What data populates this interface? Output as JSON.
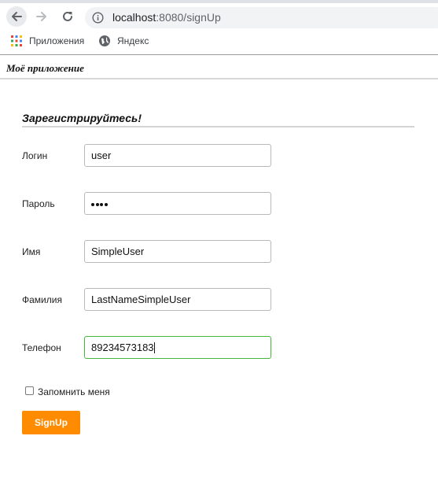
{
  "browser": {
    "url_host": "localhost",
    "url_path": ":8080/signUp",
    "bookmarks": [
      {
        "label": "Приложения",
        "icon": "apps-grid-icon"
      },
      {
        "label": "Яндекс",
        "icon": "globe-icon"
      }
    ]
  },
  "app": {
    "title": "Моё приложение"
  },
  "form": {
    "title": "Зарегистрируйтесь!",
    "fields": [
      {
        "label": "Логин",
        "value": "user"
      },
      {
        "label": "Пароль",
        "value": "••••"
      },
      {
        "label": "Имя",
        "value": "SimpleUser"
      },
      {
        "label": "Фамилия",
        "value": "LastNameSimpleUser"
      },
      {
        "label": "Телефон",
        "value": "89234573183"
      }
    ],
    "remember_label": "Запомнить меня",
    "remember_checked": false,
    "submit_label": "SignUp"
  },
  "colors": {
    "submit_bg": "#ff8c00",
    "focus_border": "#46b73b"
  }
}
